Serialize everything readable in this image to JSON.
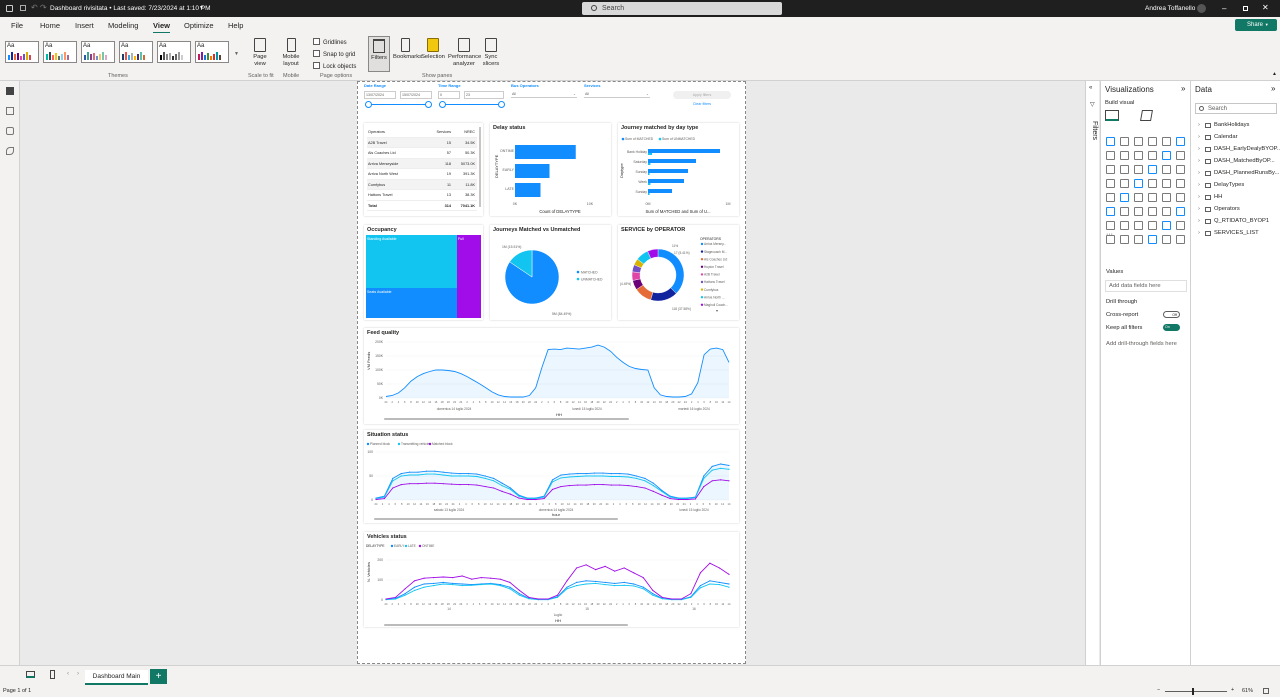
{
  "title_bar": {
    "doc_title": "Dashboard rivisitata • Last saved: 7/23/2024 at 1:10 PM",
    "search_placeholder": "Search",
    "user": "Andrea Toffanello"
  },
  "menu": [
    "File",
    "Home",
    "Insert",
    "Modeling",
    "View",
    "Optimize",
    "Help"
  ],
  "share_label": "Share",
  "ribbon": {
    "theme_sample": "Aa",
    "groups": {
      "themes": "Themes",
      "scale": "Scale to fit",
      "mobile": "Mobile",
      "page_options": "Page options",
      "show_panes": "Show panes"
    },
    "page_view": "Page view",
    "mobile_layout": "Mobile layout",
    "gridlines": "Gridlines",
    "snap": "Snap to grid",
    "lock": "Lock objects",
    "filters": "Filters",
    "bookmarks": "Bookmarks",
    "selection": "Selection",
    "perf": "Performance analyzer",
    "sync": "Sync slicers"
  },
  "slicers": {
    "date_label": "Date Range",
    "date_from": "13/07/2024",
    "date_to": "15/07/2024",
    "time_label": "Time Range",
    "time_from": "0",
    "time_to": "23",
    "bus_label": "Bus Operators",
    "bus_value": "All",
    "services_label": "Services",
    "services_value": "All",
    "apply": "Apply filters",
    "clear": "Clear filters"
  },
  "operators_table": {
    "headers": [
      "Operators",
      "Services",
      "NREC"
    ],
    "rows": [
      [
        "A2B Travel",
        "15",
        "34.5K"
      ],
      [
        "Als Coaches Ltd",
        "57",
        "50.3K"
      ],
      [
        "Arriva Merseyside",
        "118",
        "5073.0K"
      ],
      [
        "Arriva North West",
        "19",
        "391.3K"
      ],
      [
        "Cumfybus",
        "11",
        "11.8K"
      ],
      [
        "Hattons Travel",
        "13",
        "38.3K"
      ]
    ],
    "total": [
      "Total",
      "314",
      "7041.1K"
    ]
  },
  "delay_status": {
    "title": "Delay status",
    "ylabel": "DELAYTYPE",
    "xlabel": "Count of DELAYTYPE",
    "categories": [
      "ONTIME",
      "EARLY",
      "LATE"
    ],
    "values": [
      8.1,
      4.6,
      3.4
    ],
    "ticks": [
      "0K",
      "10K"
    ]
  },
  "journey_daytype": {
    "title": "Journey matched by day type",
    "legend": [
      "Sum of MATCHED",
      "Sum of UNMATCHED"
    ],
    "ylabel": "Daytype",
    "xlabel": "Sum of MATCHED and Sum of U...",
    "categories": [
      "Bank Holiday",
      "Saturday",
      "Sunday",
      "Week",
      "Sunday"
    ],
    "matched": [
      9.0,
      6.0,
      5.0,
      4.5,
      3.0
    ],
    "unmatched": [
      0.5,
      0.3,
      0.2,
      0.3,
      0.2
    ],
    "ticks": [
      "0M",
      "1M"
    ]
  },
  "occupancy": {
    "title": "Occupancy",
    "labels": [
      "Standing Available",
      "Seats Available",
      "Full"
    ],
    "colors": [
      "#12c5f1",
      "#118dff",
      "#a10de8"
    ]
  },
  "matched_pie": {
    "title": "Journeys Matched vs Unmatched",
    "legend": [
      "MATCHED",
      "UNMATCHED"
    ],
    "values": [
      84.49,
      15.51
    ],
    "label_small": "1M (15.51%)",
    "label_big": "5M (84.49%)",
    "colors": [
      "#118dff",
      "#12c5f1"
    ]
  },
  "service_donut": {
    "title": "SERVICE by OPERATOR",
    "legend_title": "OPERATORS",
    "legend": [
      "Arriva Mersey...",
      "Stagecoach M...",
      "Als Coaches Ltd",
      "Huyton Travel",
      "A2B Travel",
      "Hattons Travel",
      "Cumfybus",
      "Arriva North ...",
      "Maghull Coach..."
    ],
    "label_a": "11%",
    "label_b": "17 (5.41%)",
    "label_c": "118 (37.58%)",
    "label_d": "(4.49%)"
  },
  "feed_quality": {
    "title": "Feed quality",
    "ylabel": "VM Feeds",
    "xlabel": "HH",
    "yticks": [
      "200K",
      "150K",
      "100K",
      "50K",
      "0K"
    ],
    "day_labels": [
      "domenica 14 luglio 2024",
      "lunedì 15 luglio 2024",
      "martedì 16 luglio 2024"
    ],
    "values": [
      3,
      5,
      10,
      20,
      33,
      42,
      48,
      52,
      55,
      55,
      54,
      52,
      48,
      42,
      35,
      28,
      20,
      12,
      6,
      3,
      2,
      2,
      2,
      5,
      20,
      60,
      95,
      96,
      95,
      98,
      97,
      96,
      98,
      100,
      104,
      100,
      92,
      80,
      70,
      62,
      58,
      56,
      55,
      20,
      6,
      3,
      2,
      2,
      3,
      8,
      30,
      85,
      96,
      98,
      95,
      70
    ]
  },
  "situation": {
    "title": "Situation status",
    "xlabel": "hour",
    "legend": [
      "Planned block",
      "Transmitting vehicles",
      "Matched block"
    ],
    "yticks": [
      "100",
      "50",
      "0"
    ],
    "day_labels": [
      "sabato 13 luglio 2024",
      "domenica 14 luglio 2024",
      "lunedì 15 luglio 2024"
    ],
    "planned": [
      4,
      8,
      45,
      55,
      58,
      58,
      60,
      60,
      58,
      56,
      55,
      55,
      54,
      50,
      45,
      35,
      25,
      10,
      4,
      4,
      8,
      42,
      52,
      54,
      55,
      55,
      56,
      56,
      55,
      55,
      54,
      50,
      45,
      35,
      20,
      8,
      4,
      4,
      6,
      50,
      70,
      75,
      72
    ],
    "transmitting": [
      3,
      6,
      40,
      50,
      52,
      52,
      54,
      54,
      52,
      50,
      50,
      50,
      49,
      45,
      40,
      30,
      22,
      8,
      3,
      3,
      6,
      38,
      46,
      48,
      49,
      50,
      50,
      50,
      49,
      49,
      48,
      45,
      40,
      30,
      18,
      6,
      3,
      3,
      5,
      45,
      62,
      66,
      64
    ],
    "matched": [
      1,
      3,
      25,
      32,
      34,
      34,
      35,
      35,
      34,
      33,
      32,
      32,
      31,
      28,
      25,
      18,
      12,
      4,
      1,
      1,
      3,
      22,
      28,
      30,
      31,
      31,
      32,
      32,
      31,
      31,
      30,
      28,
      25,
      18,
      10,
      3,
      1,
      1,
      2,
      28,
      40,
      42,
      40
    ]
  },
  "vehicles": {
    "title": "Vehicles status",
    "ylabel": "N. Vehicles",
    "xlabel": "HH",
    "legend_title": "DELAYTYPE",
    "legend": [
      "EARLY",
      "LATE",
      "ONTIME"
    ],
    "yticks": [
      "200",
      "100",
      "0"
    ],
    "x_labels": [
      "14",
      "15",
      "16"
    ],
    "x_caption": "Luglio",
    "early": [
      2,
      5,
      20,
      40,
      50,
      52,
      55,
      52,
      50,
      48,
      50,
      52,
      48,
      40,
      20,
      5,
      2,
      2,
      10,
      40,
      55,
      60,
      58,
      55,
      52,
      55,
      50,
      40,
      20,
      5,
      2,
      2,
      10,
      45,
      60,
      55,
      50
    ],
    "late": [
      1,
      3,
      15,
      30,
      40,
      45,
      50,
      48,
      45,
      46,
      48,
      50,
      45,
      35,
      15,
      4,
      1,
      1,
      8,
      35,
      45,
      50,
      52,
      48,
      45,
      46,
      44,
      35,
      15,
      4,
      1,
      1,
      8,
      38,
      50,
      48,
      40
    ],
    "ontime": [
      3,
      8,
      35,
      60,
      68,
      70,
      72,
      70,
      75,
      65,
      70,
      68,
      65,
      55,
      30,
      8,
      3,
      3,
      15,
      60,
      100,
      110,
      95,
      105,
      90,
      100,
      85,
      70,
      30,
      8,
      3,
      3,
      20,
      85,
      115,
      100,
      80
    ]
  },
  "filters_rail": "Filters",
  "viz_pane": {
    "title": "Visualizations",
    "build": "Build visual",
    "values": "Values",
    "values_drop": "Add data fields here",
    "drill": "Drill through",
    "cross": "Cross-report",
    "cross_state": "Off",
    "keep": "Keep all filters",
    "keep_state": "On",
    "drill_drop": "Add drill-through fields here"
  },
  "data_pane": {
    "title": "Data",
    "search_placeholder": "Search",
    "tables": [
      "BankHolidays",
      "Calendar",
      "DASH_EarlyDealyBYOP...",
      "DASH_MatchedByOP...",
      "DASH_PlannedRunsBy...",
      "DelayTypes",
      "HH",
      "Operators",
      "Q_RTIDATO_BYOP1",
      "SERVICES_LIST"
    ]
  },
  "page_tab": "Dashboard Main",
  "status": {
    "page": "Page 1 of 1",
    "zoom": "61%"
  },
  "colors": {
    "accent": "#117865",
    "blue": "#118dff",
    "cyan": "#12c5f1",
    "purple": "#a10de8"
  }
}
